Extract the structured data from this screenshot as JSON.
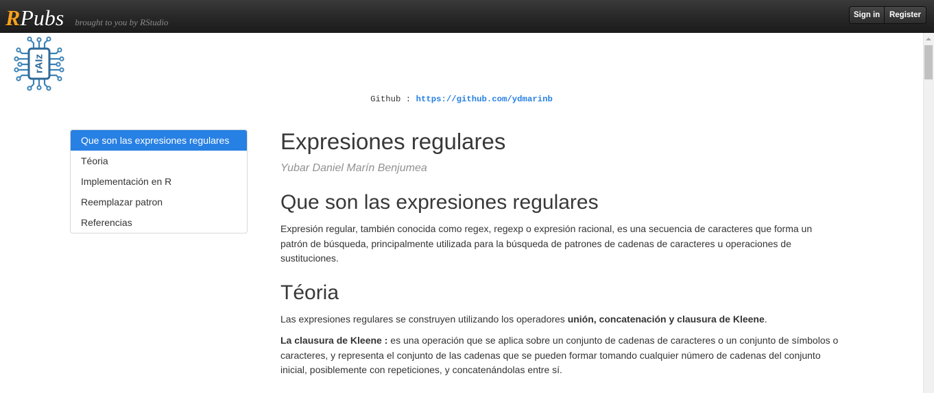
{
  "navbar": {
    "brand_r": "R",
    "brand_rest": "Pubs",
    "tagline": "brought to you by RStudio",
    "sign_in_label": "Sign in",
    "register_label": "Register"
  },
  "header": {
    "logo_text": "rAIz",
    "github_label": "Github :",
    "github_url": "https://github.com/ydmarinb"
  },
  "toc": {
    "active_index": 0,
    "items": [
      {
        "label": "Que son las expresiones regulares"
      },
      {
        "label": "Téoria"
      },
      {
        "label": "Implementación en R"
      },
      {
        "label": "Reemplazar patron"
      },
      {
        "label": "Referencias"
      }
    ]
  },
  "document": {
    "title": "Expresiones regulares",
    "author": "Yubar Daniel Marín Benjumea",
    "sections": [
      {
        "heading": "Que son las expresiones regulares",
        "paragraphs": [
          {
            "segments": [
              {
                "text": "Expresión regular, también conocida como regex, regexp o expresión racional, es una secuencia de caracteres que forma un patrón de búsqueda, principalmente utilizada para la búsqueda de patrones de cadenas de caracteres u operaciones de sustituciones.",
                "bold": false
              }
            ]
          }
        ]
      },
      {
        "heading": "Téoria",
        "paragraphs": [
          {
            "segments": [
              {
                "text": "Las expresiones regulares se construyen utilizando los operadores ",
                "bold": false
              },
              {
                "text": "unión, concatenación y clausura de Kleene",
                "bold": true
              },
              {
                "text": ".",
                "bold": false
              }
            ]
          },
          {
            "segments": [
              {
                "text": "La clausura de Kleene :",
                "bold": true
              },
              {
                "text": " es una operación que se aplica sobre un conjunto de cadenas de caracteres o un conjunto de símbolos o caracteres, y representa el conjunto de las cadenas que se pueden formar tomando cualquier número de cadenas del conjunto inicial, posiblemente con repeticiones, y concatenándolas entre sí.",
                "bold": false
              }
            ]
          }
        ]
      }
    ]
  },
  "icons": {
    "logo": "circuit-chip-icon",
    "scroll_up": "triangle-up-icon"
  },
  "colors": {
    "accent": "#2780e3",
    "brand_orange": "#f6a21d",
    "text": "#333333",
    "logo_blue": "#3b82b6"
  }
}
